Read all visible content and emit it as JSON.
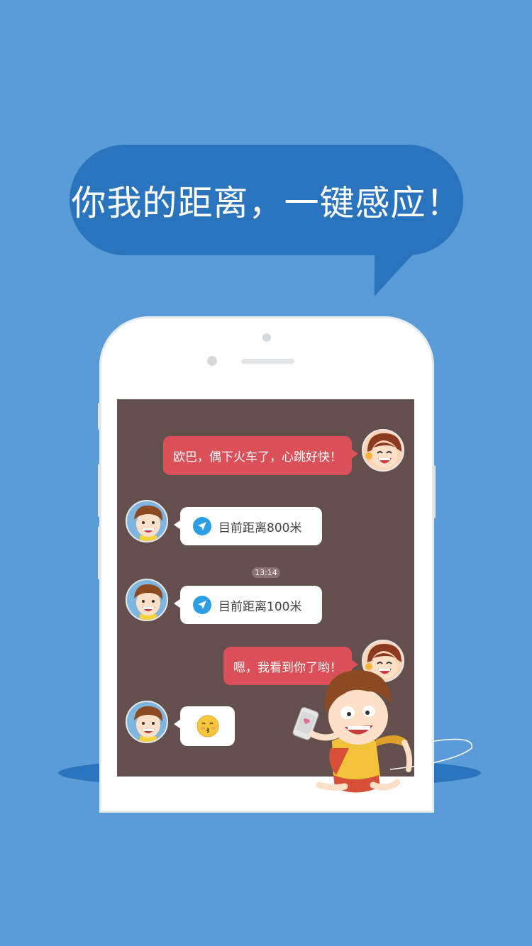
{
  "headline": {
    "text": "你我的距离，一键感应！"
  },
  "chat": {
    "messages": [
      {
        "sender": "girl",
        "type": "text",
        "text": "欧巴，偶下火车了，心跳好快！"
      },
      {
        "sender": "boy",
        "type": "location",
        "text": "目前距离800米"
      },
      {
        "sender": "boy",
        "type": "location",
        "text": "目前距离100米"
      },
      {
        "sender": "girl",
        "type": "text",
        "text": "嗯，我看到你了哟！"
      },
      {
        "sender": "boy",
        "type": "emoji",
        "emoji": "kissing-face"
      }
    ],
    "timestamp": "13:14"
  },
  "colors": {
    "background": "#5b9bd8",
    "speech_bubble": "#2a73bd",
    "screen": "#634f4c",
    "red_bubble": "#db5058",
    "location_icon": "#2d9de4"
  },
  "icons": [
    "location-arrow-icon",
    "kissing-emoji-icon",
    "heart-icon"
  ]
}
